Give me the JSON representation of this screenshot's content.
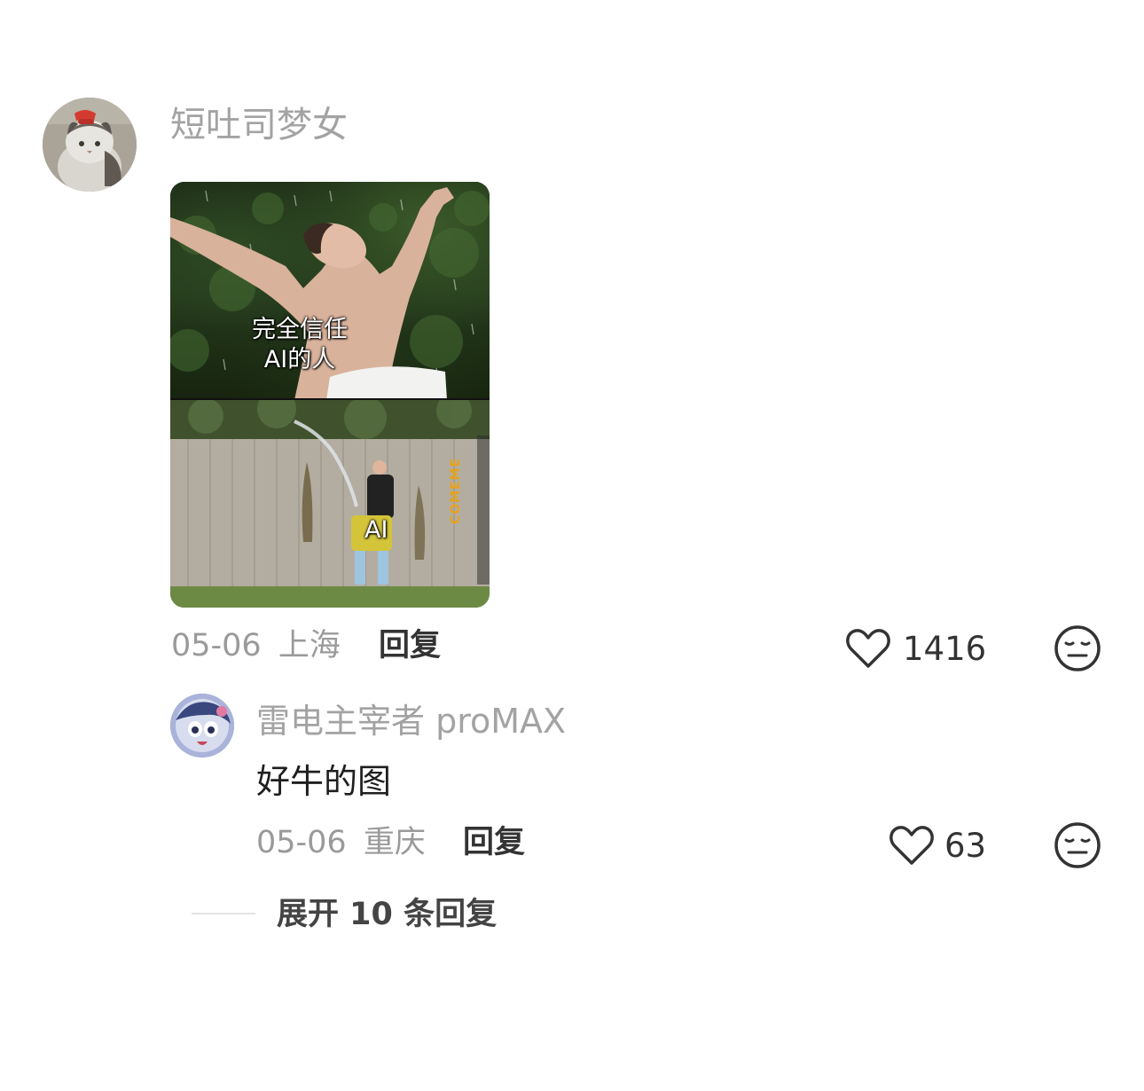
{
  "comment": {
    "username": "短吐司梦女",
    "image": {
      "caption_top": "完全信任\nAI的人",
      "caption_bottom": "AI",
      "watermark": "COMEME"
    },
    "date": "05-06",
    "location": "上海",
    "reply_label": "回复",
    "likes": "1416",
    "icons": {
      "like": "heart-outline-icon",
      "dislike": "meh-face-icon"
    }
  },
  "sub_comment": {
    "username": "雷电主宰者 proMAX",
    "content": "好牛的图",
    "date": "05-06",
    "location": "重庆",
    "reply_label": "回复",
    "likes": "63"
  },
  "expand_replies_label": "展开 10 条回复",
  "colors": {
    "secondary_text": "#9a9a9a",
    "username": "#a3a3a3",
    "primary_text": "#1f1f1f",
    "icon_stroke": "#333333"
  }
}
